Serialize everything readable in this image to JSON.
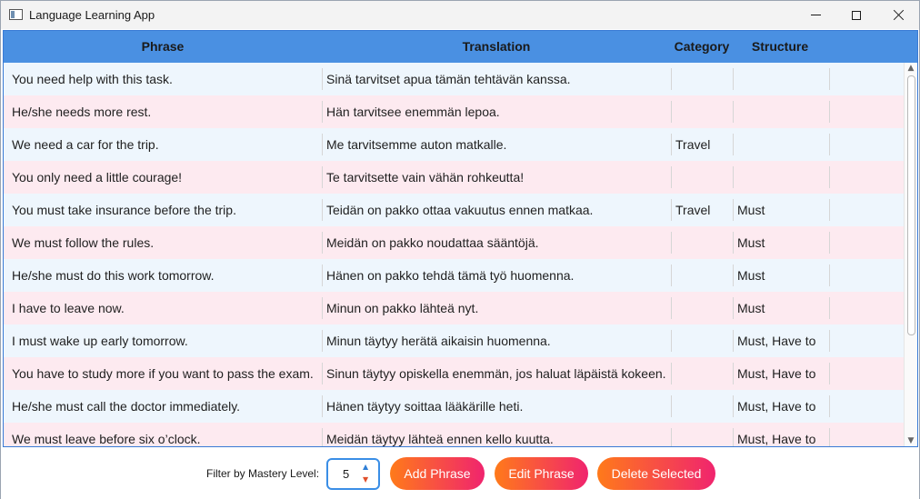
{
  "window": {
    "title": "Language Learning App",
    "icons": {
      "app": "app-window-icon",
      "minimize": "minimize-icon",
      "maximize": "maximize-icon",
      "close": "close-icon"
    }
  },
  "table": {
    "columns": {
      "phrase": "Phrase",
      "translation": "Translation",
      "category": "Category",
      "structure": "Structure"
    },
    "rows": [
      {
        "phrase": "You need help with this task.",
        "translation": "Sinä tarvitset apua tämän tehtävän kanssa.",
        "category": "",
        "structure": ""
      },
      {
        "phrase": "He/she needs more rest.",
        "translation": "Hän tarvitsee enemmän lepoa.",
        "category": "",
        "structure": ""
      },
      {
        "phrase": "We need a car for the trip.",
        "translation": "Me tarvitsemme auton matkalle.",
        "category": "Travel",
        "structure": ""
      },
      {
        "phrase": "You only need a little courage!",
        "translation": "Te tarvitsette vain vähän rohkeutta!",
        "category": "",
        "structure": ""
      },
      {
        "phrase": "You must take insurance before the trip.",
        "translation": "Teidän on pakko ottaa vakuutus ennen matkaa.",
        "category": "Travel",
        "structure": "Must"
      },
      {
        "phrase": "We must follow the rules.",
        "translation": "Meidän on pakko noudattaa sääntöjä.",
        "category": "",
        "structure": "Must"
      },
      {
        "phrase": "He/she must do this work tomorrow.",
        "translation": "Hänen on pakko tehdä tämä työ huomenna.",
        "category": "",
        "structure": "Must"
      },
      {
        "phrase": "I have to leave now.",
        "translation": "Minun on pakko lähteä nyt.",
        "category": "",
        "structure": "Must"
      },
      {
        "phrase": "I must wake up early tomorrow.",
        "translation": "Minun täytyy herätä aikaisin huomenna.",
        "category": "",
        "structure": "Must, Have to"
      },
      {
        "phrase": "You have to study more if you want to pass the exam.",
        "translation": "Sinun täytyy opiskella enemmän, jos haluat läpäistä kokeen.",
        "category": "",
        "structure": "Must, Have to"
      },
      {
        "phrase": "He/she must call the doctor immediately.",
        "translation": "Hänen täytyy soittaa lääkärille heti.",
        "category": "",
        "structure": "Must, Have to"
      },
      {
        "phrase": "We must leave before six o’clock.",
        "translation": "Meidän täytyy lähteä ennen kello kuutta.",
        "category": "",
        "structure": "Must, Have to"
      }
    ]
  },
  "controls": {
    "filter_label": "Filter by Mastery Level:",
    "mastery_level": "5",
    "add_label": "Add Phrase",
    "edit_label": "Edit Phrase",
    "delete_label": "Delete Selected"
  },
  "colors": {
    "header": "#4a90e2",
    "row_odd": "#eef6fd",
    "row_even": "#fdeaf0",
    "button_gradient_start": "#ff7a1a",
    "button_gradient_end": "#f0246e"
  }
}
